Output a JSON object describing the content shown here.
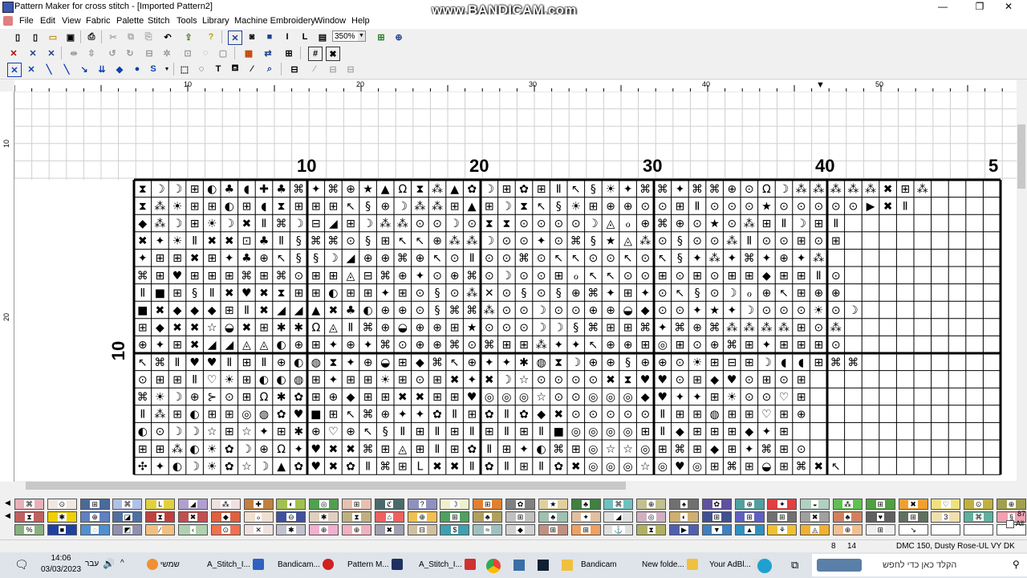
{
  "window": {
    "title": "Pattern Maker for cross stitch - [Imported Pattern2]",
    "watermark": "www.BANDICAM.com",
    "controls": {
      "minimize": "—",
      "restore": "❐",
      "close": "✕"
    }
  },
  "menu": [
    "File",
    "Edit",
    "View",
    "Fabric",
    "Palette",
    "Stitch",
    "Tools",
    "Library",
    "Machine Embroidery",
    "Window",
    "Help"
  ],
  "toolbar": {
    "zoom_value": "350%"
  },
  "ruler": {
    "top_labels": [
      "10",
      "20",
      "30",
      "40",
      "50"
    ],
    "left_labels": [
      "10",
      "20"
    ]
  },
  "chart": {
    "top_labels": [
      "10",
      "20",
      "30",
      "40",
      "5"
    ],
    "left_label": "10",
    "symbols": "⌂✦☽⊞◐♣◖✚⌘⊕★▲Ω♠✖⊡◉☀♥◆▣↖§⊙⧗⁂◑✿⚘Ⅱ♦▼◧",
    "rows": [
      "⧗☽☽⊞◐♣◖✚♣⌘✦⌘⊕★▲Ω⧗⁂▲✿☽⊞✿⊞Ⅱ↖§☀✦⌘⌘✦⌘⌘⊕⊙Ω☽⁂⁂⁂⁂⁂✖⊞⁂",
      "⧗⁂☀⊞⊞◐⊞◖⧗⊞⊞⊞↖§⊕☽⁂⁂⊞▲⊞☽⧗↖§☀⊞⊕⊕⊙⊙⊞Ⅱ⊙⊙⊙★⊙⊙⊙⊙⊙▶✖Ⅱ",
      "◆⁂☽⊞☀☽✖Ⅱ⌘☽⊟◢⊞☽⁂⁂⊙⊙☽⊙⧗⧗⊙⊙⊙⊙☽◬ℴ⊕⌘⊕⊙★⊙⁂⊞Ⅱ☽⊞Ⅱ",
      "✖✦☀Ⅱ✖✖⊡♣Ⅱ§⌘⌘⊙§⊞↖↖⊕⁂⁂☽⊙⊙✦⊙⌘§★◬⁂⊙§⊙⊙⁂Ⅱ⊙⊙⊞⊙⊞",
      "✦⊞⊞✖⊞✦♣⊕↖§§☽◢⊕⊕⌘⊕↖⊙Ⅱ⊙⊙⌘⊙↖↖⊙⊙↖⊙↖§✦⁂✦⌘✦⊕✦⁂",
      "⌘⊞♥⊞⊞⊞⌘⊞⌘⊙⊞⊞◬⊟⌘⊕✦⊙⊕⌘⊙☽⊙⊙⊞ℴ↖↖⊙⊙⊞⊙⊞⊙⊞⊞◆⊞⊞Ⅱ⊙",
      "Ⅱ■⊞§Ⅱ✖♥✖⧗⊞⊞◐⊞⊞✦⊞⊙§⊙⁂✕⊙§⊙§⊕⌘✦⊞✦⊙↖§⊙☽ℴ⊕↖⊞⊕⊕",
      "■✖◆◆◆⊞Ⅱ✖◢◢▲✖♣◐⊕⊕⊙§⌘⌘⁂⊙⊙☽⊙⊙⊕⊕◒◆⊙⊙✦★✦☽⊙⊙⊙☀⊙☽",
      "⊞◆✖✖☆◒✖⊞✱✱Ω◬Ⅱ⌘⊕◒⊕⊕⊞★⊙⊙⊙☽☽§⌘⊞⊞⌘✦⌘⊕⌘⁂⁂⁂⁂⊞⊙⁂",
      "⊕✦⊞✖◢◢◬◬◐⊕⊞✦⊕✦⌘⊙⊕⊕⌘⊙⌘⊞⊞⁂✦✦↖⊕⊕⊞◎⊞⊙⊕⌘⊞✦⊞⊞⊞⊙",
      "↖⌘Ⅱ♥♥Ⅱ⊞Ⅱ⊕◐◍⧗✦⊕◒⊞◆⌘↖⊕✦✦✱◍⧗☽⊕⊕§⊕⊕⊙☀⊞⊟⊞☽◖◖⊞⌘⌘",
      "⊙⊞⊞Ⅱ♡☀⊞◐◐◍⊞✦⊞⊞☀⊞⊙⊞✖✦✖☽☆⊙⊙⊙⊙✖⧗♥♥⊙⊞◆♥⊙⊞⊙⊞",
      "⌘☀☽⊕⊱⊙⊞Ω✱✿⊞⊕◆⊞⊞✖✖⊞⊞♥◎◎◎☆⊙⊙◎◎◎◆♥✦✦⊞☀⊙⊙♡⊞",
      "Ⅱ⁂⊞◐⊞⊞◎◍✿♥■⊞↖⌘⊕✦✦✿Ⅱ⊞✿Ⅱ✿◆✖⊙⊙⊙⊙⊙Ⅱ⊞⊞◍⊞⊞♡⊞⊕",
      "◐⊙☽☽☆⊞☆✦⊞✱⊕♡⊕↖§Ⅱ⊞Ⅱ⊞Ⅱ⊞Ⅱ⊞Ⅱ■◎◎◎◎⊞Ⅱ◆⊞⊞⊞◆✦⊞",
      "⊞⊞⁂◐☀✿☽⊕Ω✦♥✖✖⌘⊞◬⊞Ⅱ⊞✿Ⅱ⊞✦◐⌘⊞◎☆☆◎⊞⌘⊞◆⊞✦⌘⊞⊙",
      "✣✦◐☽☀✿☆☽▲✿♥✖✿Ⅱ⌘⊞L✖✖Ⅱ✿Ⅱ⊞Ⅱ✿✖◎◎◎☆◎♥◎⊞⌘⊞◒⊞⌘✖↖"
    ]
  },
  "palette": {
    "row1": [
      "⌘",
      "⊙",
      "⊞",
      "⌘",
      "L",
      "◢",
      "⁂",
      "✚",
      "◐",
      "◎",
      "⊞",
      "ℭ",
      "?",
      "☽",
      "⊞",
      "✿",
      "★",
      "♣",
      "⌘",
      "⊕",
      "♠",
      "✿",
      "⊕",
      "✦",
      "◒",
      "⁂",
      "⊞",
      "✖",
      "♡",
      "⊙",
      "⊕"
    ],
    "row2": [
      "⧗",
      "✱",
      "⊕",
      "◪",
      "⧗",
      "✖",
      "◆",
      "ℴ",
      "⊖",
      "✱",
      "⧗",
      "⌂",
      "⊕",
      "⊞",
      "♣",
      "⊞",
      "♣",
      "✦",
      "◢",
      "◎",
      "◐",
      "⊞",
      "⊞",
      "⊞",
      "✖",
      "♣",
      "♥",
      "⊞",
      "3",
      "⌘",
      "§"
    ],
    "row3": [
      "%",
      "■",
      "◌",
      "◩",
      "∕",
      "‹",
      "⊙",
      "✕",
      "✱",
      "⊕",
      "⊕",
      "✖",
      "⊟",
      "$",
      "≈",
      "◆",
      "⊞",
      "⊞",
      "⚓",
      "⧗",
      "▶",
      "▼",
      "▲",
      "⚘",
      "◬",
      "⊕",
      "⊞",
      "↘",
      "",
      "",
      ""
    ],
    "row1_colors": [
      "#e8b0b8",
      "#f0e8e0",
      "#4a6a9a",
      "#b0c0e8",
      "#e0d040",
      "#b0a0d0",
      "#f0e0e0",
      "#c08040",
      "#a0c050",
      "#50a050",
      "#e8c0b0",
      "#4a6a6a",
      "#9090c0",
      "#f0f0d0",
      "#e08030",
      "#808080",
      "#e0d0a0",
      "#408040",
      "#70c0c0",
      "#c0c090",
      "#707070",
      "#6050a0",
      "#50a0a0",
      "#e04040",
      "#b0d0c0",
      "#60c050",
      "#50a040",
      "#f0a030",
      "#f0e080",
      "#c0b040",
      "#a0a050"
    ],
    "row2_colors": [
      "#c06060",
      "#f0d000",
      "#6080c0",
      "#5070a0",
      "#c04040",
      "#c05050",
      "#e06040",
      "#f0e0d0",
      "#4050a0",
      "#e0d0c0",
      "#c0b080",
      "#f06060",
      "#f0c050",
      "#50a060",
      "#b0a060",
      "#c0c0c0",
      "#a0c0b0",
      "#e0c0a0",
      "#e0e0e0",
      "#d0b0c0",
      "#d0b070",
      "#405090",
      "#6060c0",
      "#707070",
      "#a0a0a0",
      "#d08060",
      "#606060",
      "#607060",
      "#f0e0b0",
      "#60b0a0",
      "#f0a0b0"
    ],
    "row3_colors": [
      "#8ab080",
      "#2040a0",
      "#5090d0",
      "#9090b0",
      "#f0c080",
      "#b0d0b0",
      "#f07050",
      "#f0e0e0",
      "#c0c0d0",
      "#f0b0d0",
      "#f0b0c0",
      "#a0a0b0",
      "#d0c0a0",
      "#40a0b0",
      "#a0c0c0",
      "#d0d0d0",
      "#c09080",
      "#f0a060",
      "#e0e0e0",
      "#b0b060",
      "#5060b0",
      "#4080c0",
      "#3090c0",
      "#f0c030",
      "#f0b030",
      "#f0c090",
      "#f0f0f0",
      "#ffffff",
      "#ffffff",
      "#ffffff",
      "#ffffff"
    ],
    "counter": "87",
    "all_label": "All"
  },
  "status": {
    "col": "8",
    "row": "14",
    "thread": "DMC  150, Dusty Rose-UL VY DK"
  },
  "taskbar": {
    "time": "14:06",
    "date": "03/03/2023",
    "lang": "עבר",
    "items": [
      "שמשי",
      "A_Stitch_I...",
      "Bandicam...",
      "Pattern M...",
      "A_Stitch_I...",
      "Bandicam",
      "New folde...",
      "Your AdBl..."
    ],
    "search_placeholder": "הקלד כאן כדי לחפש"
  }
}
